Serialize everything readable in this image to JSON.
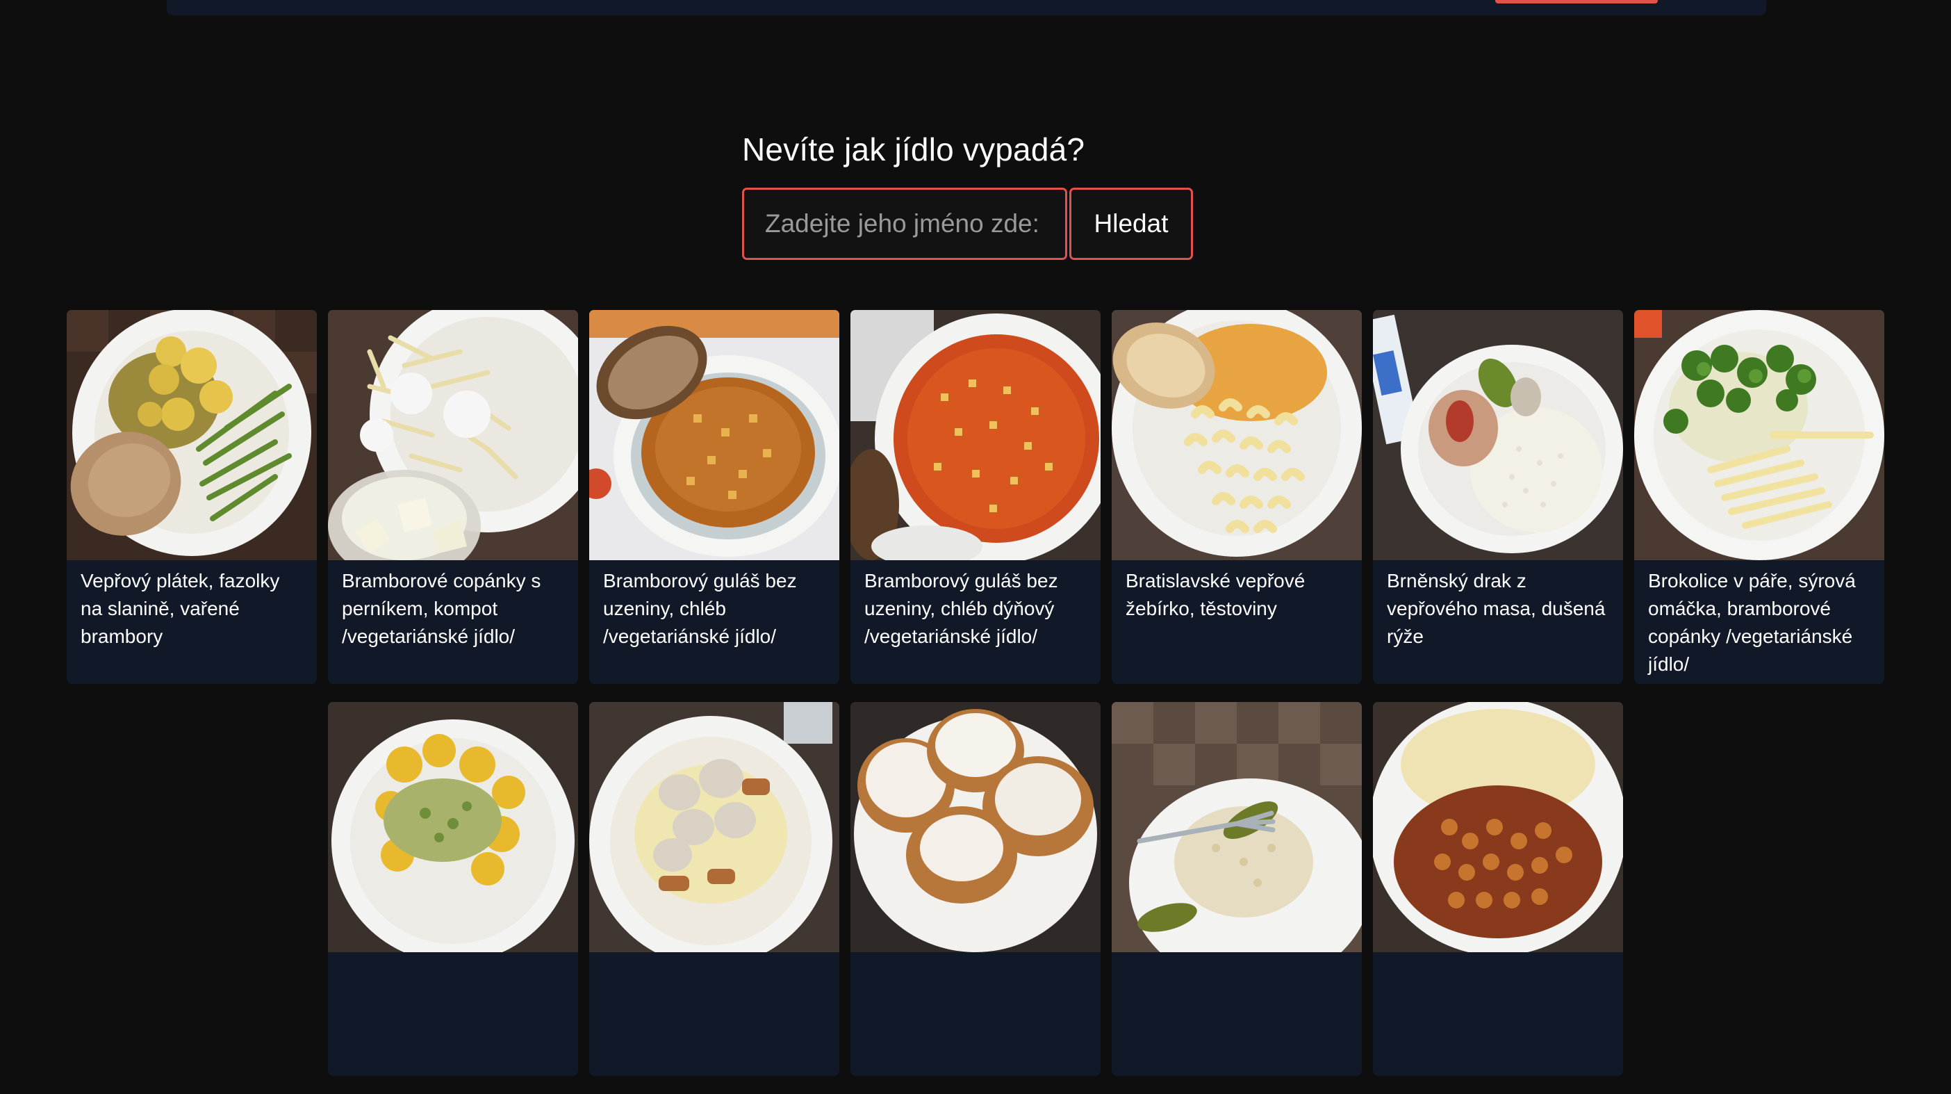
{
  "search": {
    "title": "Nevíte jak jídlo vypadá?",
    "placeholder": "Zadejte jeho jméno zde:",
    "value": "",
    "button_label": "Hledat"
  },
  "colors": {
    "accent": "#e0524c",
    "card_background": "#111827",
    "page_background": "#0e0e0f"
  },
  "meals": [
    {
      "name": "Vepřový plátek, fazolky na slanině, vařené brambory",
      "icon": "meal-photo"
    },
    {
      "name": "Bramborové copánky s perníkem, kompot /vegetariánské jídlo/",
      "icon": "meal-photo"
    },
    {
      "name": "Bramborový guláš bez uzeniny, chléb /vegetariánské jídlo/",
      "icon": "meal-photo"
    },
    {
      "name": "Bramborový guláš bez uzeniny, chléb dýňový /vegetariánské jídlo/",
      "icon": "meal-photo"
    },
    {
      "name": "Bratislavské vepřové žebírko, těstoviny",
      "icon": "meal-photo"
    },
    {
      "name": "Brněnský drak z vepřového masa, dušená rýže",
      "icon": "meal-photo"
    },
    {
      "name": "Brokolice v páře, sýrová omáčka, bramborové copánky /vegetariánské jídlo/",
      "icon": "meal-photo"
    },
    {
      "name": "",
      "icon": "meal-photo"
    },
    {
      "name": "",
      "icon": "meal-photo"
    },
    {
      "name": "",
      "icon": "meal-photo"
    },
    {
      "name": "",
      "icon": "meal-photo"
    },
    {
      "name": "",
      "icon": "meal-photo"
    }
  ]
}
